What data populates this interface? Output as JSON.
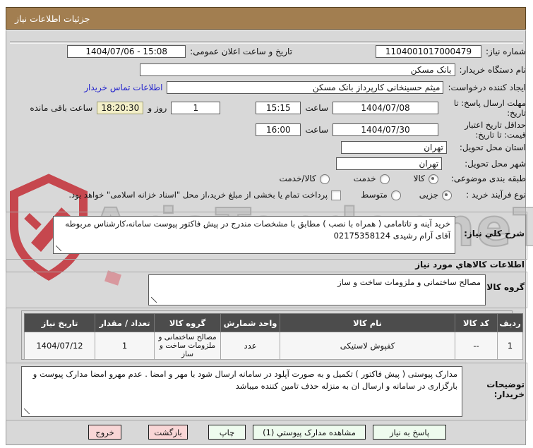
{
  "header": {
    "title": "جزئیات اطلاعات نیاز"
  },
  "watermark": {
    "text": "AriaTender.neT",
    "logo_color": "#c2242c"
  },
  "colors": {
    "titlebar_bg": "#a27e50",
    "page_bg": "#d8d8d8",
    "table_header_bg": "#4c4c4c",
    "highlight_yellow": "#f3efc8",
    "button_green": "#eefbee",
    "button_pink": "#f9d6d6",
    "link_blue": "#2323cc"
  },
  "form": {
    "need_number": {
      "label": "شماره نیاز:",
      "value": "1104001017000479"
    },
    "announce_datetime": {
      "label": "تاریخ و ساعت اعلان عمومی:",
      "value": "1404/07/06 - 15:08"
    },
    "buyer_org": {
      "label": "نام دستگاه خریدار:",
      "value": "بانک مسکن"
    },
    "request_creator": {
      "label": "ایجاد کننده درخواست:",
      "value": "میثم حسینخانی کارپرداز بانک مسکن"
    },
    "contact_link": "اطلاعات تماس خریدار",
    "reply_deadline": {
      "label": "مهلت ارسال پاسخ: تا\nتاریخ:",
      "date": "1404/07/08",
      "time_label": "ساعت",
      "time": "15:15",
      "remain_days": "1",
      "remain_days_label": "روز و",
      "remain_time": "18:20:30",
      "remain_time_label": "ساعت باقی مانده"
    },
    "price_validity": {
      "label": "حداقل تاریخ اعتبار\nقیمت: تا تاریخ:",
      "date": "1404/07/30",
      "time_label": "ساعت",
      "time": "16:00"
    },
    "province": {
      "label": "استان محل تحویل:",
      "value": "تهران"
    },
    "city": {
      "label": "شهر محل تحویل:",
      "value": "تهران"
    },
    "subject_class": {
      "label": "طبقه بندی موضوعی:",
      "options": [
        "کالا",
        "خدمت",
        "کالا/خدمت"
      ],
      "selected": "کالا"
    },
    "purchase_type": {
      "label": "نوع فرآیند خرید :",
      "options": [
        "جزیی",
        "متوسط"
      ],
      "selected": "جزیی",
      "checkbox_label": "پرداخت تمام یا بخشی از مبلغ خرید،از محل \"اسناد خزانه اسلامی\" خواهد بود.",
      "checkbox_checked": false
    }
  },
  "description": {
    "label": "شرح کلي نیاز:",
    "value": "خرید آینه و تاتامامی ( همراه با نصب ) مطابق با مشخصات مندرج در پیش فاکتور پیوست سامانه،کارشناس مربوطه  آقای آرام رشیدی 02175358124"
  },
  "items_section": {
    "title": "اطلاعات کالاهاي مورد نیاز",
    "group": {
      "label": "گروه کالا:",
      "value": "مصالح ساختمانی و ملزومات ساخت و ساز"
    },
    "table": {
      "headers": [
        "ردیف",
        "کد کالا",
        "نام کالا",
        "واحد شمارش",
        "گروه کالا",
        "تعداد / مقدار",
        "تاریخ نیاز"
      ],
      "rows": [
        [
          "1",
          "--",
          "کفپوش لاستیکی",
          "عدد",
          "مصالح ساختمانی و ملزومات ساخت و ساز",
          "1",
          "1404/07/12"
        ]
      ]
    }
  },
  "buyer_notes": {
    "label": "توضیحات\nخریدار:",
    "value": "مدارک پیوستی ( پیش فاکتور ) تکمیل و به صورت آپلود در سامانه ارسال شود با مهر و امضا . عدم مهرو امضا مدارک پیوست و بارگزاری در سامانه  و ارسال ان به منزله حذف تامین کننده  میباشد"
  },
  "buttons": {
    "exit": "خروج",
    "back": "بازگشت",
    "print": "چاپ",
    "attachments": "مشاهده مدارک پیوستي (1)",
    "reply": "پاسخ به نیاز"
  }
}
